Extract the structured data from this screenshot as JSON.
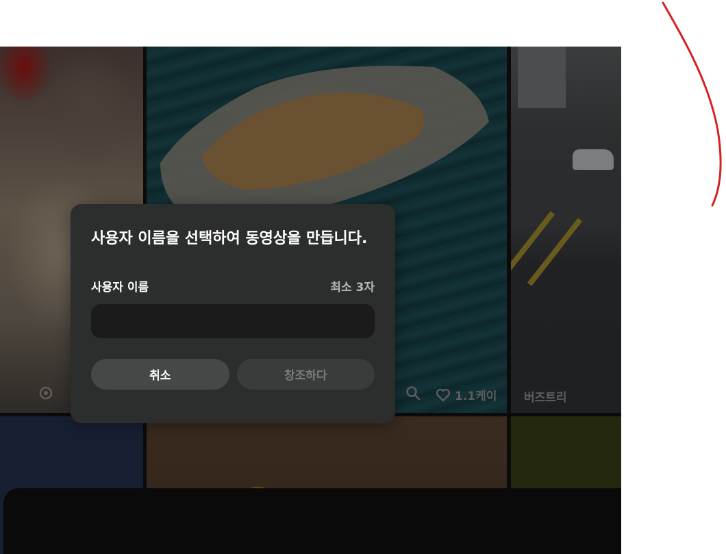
{
  "background_feed": {
    "tiles": [
      {
        "id": "painter",
        "stats": {
          "remix_icon": "remix-icon"
        }
      },
      {
        "id": "cat-float",
        "stats": {
          "search_icon": "search-icon",
          "likes": "1.1케이"
        }
      },
      {
        "id": "street",
        "stats": {
          "author": "버즈트리"
        }
      },
      {
        "id": "blue"
      },
      {
        "id": "paper-craft"
      },
      {
        "id": "green"
      }
    ]
  },
  "dialog": {
    "title": "사용자 이름을 선택하여 동영상을 만듭니다.",
    "field_label": "사용자 이름",
    "field_hint": "최소 3자",
    "input_value": "",
    "cancel_label": "취소",
    "create_label": "창조하다"
  },
  "colors": {
    "dialog_bg": "#2c2d2d",
    "input_bg": "#1b1b1b",
    "annotation": "#d62121"
  }
}
